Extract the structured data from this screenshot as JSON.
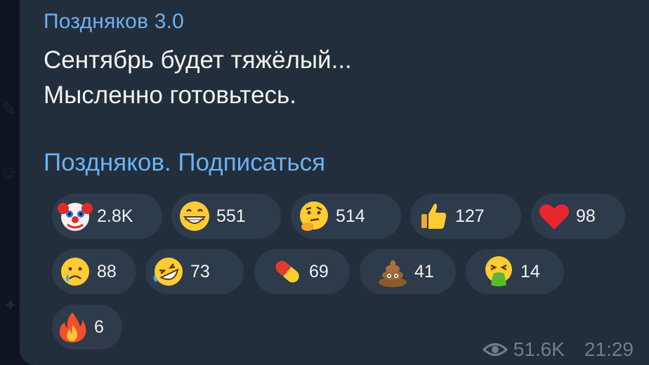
{
  "post": {
    "author": "Поздняков 3.0",
    "text_line_1": "Сентябрь будет тяжёлый...",
    "text_line_2": "Мысленно готовьтесь.",
    "subscribe_link": "Поздняков. Подписаться",
    "views": "51.6K",
    "time": "21:29"
  },
  "reactions": [
    {
      "emoji": "clown-icon",
      "count": "2.8K"
    },
    {
      "emoji": "grinning-face-icon",
      "count": "551"
    },
    {
      "emoji": "thinking-face-icon",
      "count": "514"
    },
    {
      "emoji": "thumbs-up-icon",
      "count": "127"
    },
    {
      "emoji": "red-heart-icon",
      "count": "98"
    },
    {
      "emoji": "crying-face-icon",
      "count": "88"
    },
    {
      "emoji": "rofl-face-icon",
      "count": "73"
    },
    {
      "emoji": "pill-icon",
      "count": "69"
    },
    {
      "emoji": "poop-icon",
      "count": "41"
    },
    {
      "emoji": "vomiting-face-icon",
      "count": "14"
    },
    {
      "emoji": "fire-icon",
      "count": "6"
    }
  ],
  "colors": {
    "bubble": "#232e3c",
    "reaction_pill": "#2e3b4c",
    "link": "#6ab2f2",
    "meta": "#6d7f8f"
  }
}
